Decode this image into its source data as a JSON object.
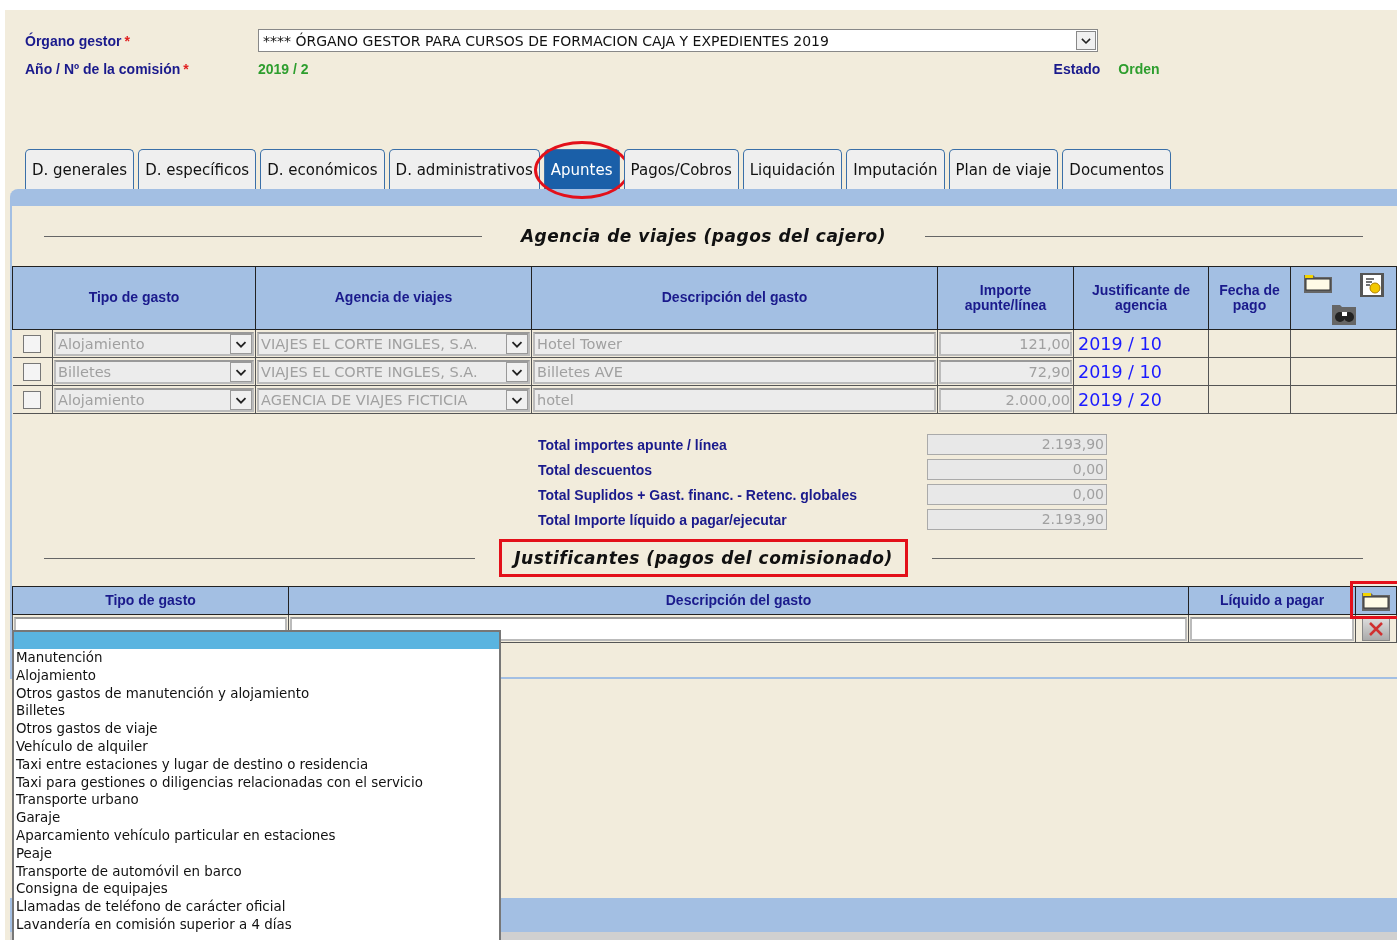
{
  "organo": {
    "label": "Órgano gestor",
    "required_mark": "*",
    "value": "**** ÓRGANO GESTOR PARA CURSOS DE FORMACION CAJA Y EXPEDIENTES 2019"
  },
  "comision": {
    "label": "Año / Nº de la comisión",
    "required_mark": "*",
    "value": "2019 / 2"
  },
  "estado": {
    "label": "Estado",
    "value": "Orden"
  },
  "tabs": [
    {
      "label": "D. generales",
      "selected": false,
      "highlighted": false
    },
    {
      "label": "D. específicos",
      "selected": false,
      "highlighted": false
    },
    {
      "label": "D. económicos",
      "selected": false,
      "highlighted": false
    },
    {
      "label": "D. administrativos",
      "selected": false,
      "highlighted": false
    },
    {
      "label": "Apuntes",
      "selected": true,
      "highlighted": true
    },
    {
      "label": "Pagos/Cobros",
      "selected": false,
      "highlighted": false
    },
    {
      "label": "Liquidación",
      "selected": false,
      "highlighted": false
    },
    {
      "label": "Imputación",
      "selected": false,
      "highlighted": false
    },
    {
      "label": "Plan de viaje",
      "selected": false,
      "highlighted": false
    },
    {
      "label": "Documentos",
      "selected": false,
      "highlighted": false
    }
  ],
  "agency_section": {
    "title": "Agencia de viajes (pagos del cajero)",
    "highlighted": false,
    "columns": [
      "Tipo de gasto",
      "Agencia de viajes",
      "Descripción del gasto",
      "Importe apunte/línea",
      "Justificante de agencia",
      "Fecha de pago"
    ],
    "rows": [
      {
        "checked": false,
        "disabled": true,
        "tipo": "Alojamiento",
        "agencia": "VIAJES EL CORTE INGLES, S.A.",
        "descripcion": "Hotel Tower",
        "importe": "121,00",
        "justificante": "2019 / 10"
      },
      {
        "checked": false,
        "disabled": true,
        "tipo": "Billetes",
        "agencia": "VIAJES EL CORTE INGLES, S.A.",
        "descripcion": "Billetes AVE",
        "importe": "72,90",
        "justificante": "2019 / 10"
      },
      {
        "checked": false,
        "disabled": true,
        "tipo": "Alojamiento",
        "agencia": "AGENCIA DE VIAJES FICTICIA",
        "descripcion": "hotel",
        "importe": "2.000,00",
        "justificante": "2019 / 20"
      }
    ]
  },
  "totals": [
    {
      "label": "Total importes apunte / línea",
      "value": "2.193,90"
    },
    {
      "label": "Total descuentos",
      "value": "0,00"
    },
    {
      "label": "Total Suplidos + Gast. financ. - Retenc. globales",
      "value": "0,00"
    },
    {
      "label": "Total Importe líquido a pagar/ejecutar",
      "value": "2.193,90"
    }
  ],
  "claims_section": {
    "title": "Justificantes (pagos del comisionado)",
    "highlighted": true,
    "add_highlighted": true,
    "columns": [
      "Tipo de gasto",
      "Descripción del gasto",
      "Líquido a pagar"
    ]
  },
  "dropdown": {
    "blank_selected": true,
    "options": [
      "Manutención",
      "Alojamiento",
      "Otros gastos de manutención y alojamiento",
      "Billetes",
      "Otros gastos de viaje",
      "Vehículo de alquiler",
      "Taxi entre estaciones y lugar de destino o residencia",
      "Taxi para gestiones o diligencias relacionadas con el servicio",
      "Transporte urbano",
      "Garaje",
      "Aparcamiento vehículo particular en estaciones",
      "Peaje",
      "Transporte de automóvil en barco",
      "Consigna de equipajes",
      "Llamadas de teléfono de carácter oficial",
      "Lavandería en comisión superior a 4 días"
    ]
  }
}
